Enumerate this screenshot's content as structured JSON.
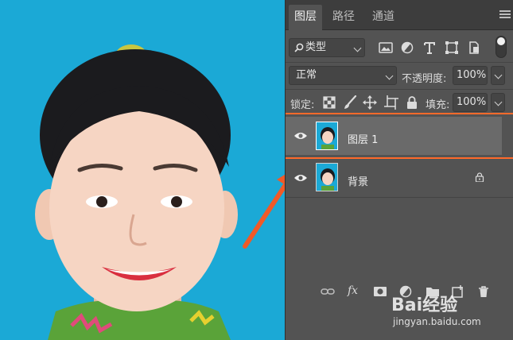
{
  "tabs": [
    "图层",
    "路径",
    "通道"
  ],
  "filter": {
    "select_label": "类型"
  },
  "blend": {
    "mode": "正常",
    "opacity_label": "不透明度:",
    "opacity_value": "100%",
    "lock_label": "锁定:",
    "fill_label": "填充:",
    "fill_value": "100%"
  },
  "layers": [
    {
      "name": "图层 1",
      "visible": true,
      "selected": true,
      "locked": false
    },
    {
      "name": "背景",
      "visible": true,
      "selected": false,
      "locked": true
    }
  ],
  "watermark": {
    "logo": "Bai经验",
    "url": "jingyan.baidu.com"
  },
  "colors": {
    "canvas_bg": "#1ba9d6",
    "panel_bg": "#535353",
    "highlight_frame": "#ff6a2b",
    "arrow": "#f05a28"
  },
  "icons": [
    "search-icon",
    "image-filter-icon",
    "adjustment-filter-icon",
    "type-filter-icon",
    "shape-filter-icon",
    "smart-object-filter-icon",
    "lock-pixels-icon",
    "lock-paint-icon",
    "lock-move-icon",
    "lock-artboard-icon",
    "lock-all-icon",
    "eye-icon",
    "link-icon",
    "mask-icon",
    "adjustment-icon",
    "folder-icon",
    "new-layer-icon",
    "trash-icon"
  ]
}
